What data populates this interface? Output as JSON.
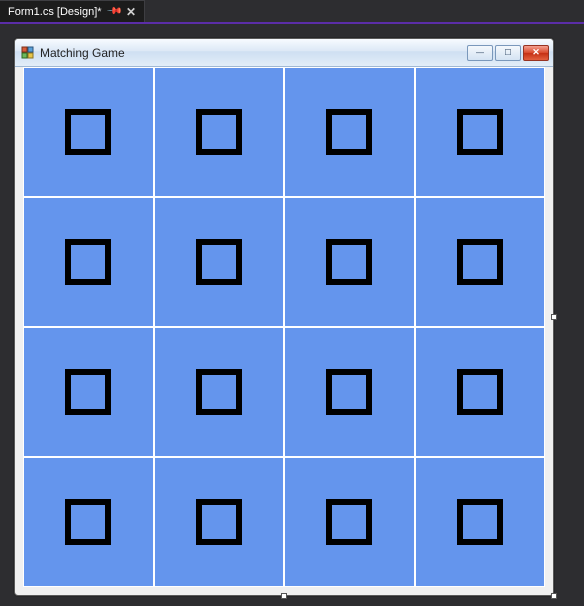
{
  "tab": {
    "label": "Form1.cs [Design]*",
    "pin_icon": "📌",
    "close_icon": "✕"
  },
  "window": {
    "title": "Matching Game",
    "min_glyph": "—",
    "max_glyph": "☐",
    "close_glyph": "✕"
  },
  "grid": {
    "rows": 4,
    "cols": 4,
    "cells": [
      {
        "icon": "square"
      },
      {
        "icon": "square"
      },
      {
        "icon": "square"
      },
      {
        "icon": "square"
      },
      {
        "icon": "square"
      },
      {
        "icon": "square"
      },
      {
        "icon": "square"
      },
      {
        "icon": "square"
      },
      {
        "icon": "square"
      },
      {
        "icon": "square"
      },
      {
        "icon": "square"
      },
      {
        "icon": "square"
      },
      {
        "icon": "square"
      },
      {
        "icon": "square"
      },
      {
        "icon": "square"
      },
      {
        "icon": "square"
      }
    ]
  },
  "colors": {
    "board": "#6495ed",
    "cell_border": "#ffffff",
    "card_outline": "#000000"
  }
}
